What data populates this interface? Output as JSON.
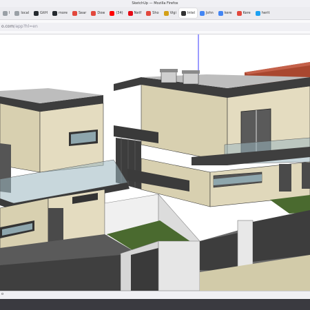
{
  "window": {
    "title": "SketchUp — Mozilla Firefox"
  },
  "tabs": [
    {
      "label": "l",
      "icon": "doc-icon",
      "color": "#9aa0a6"
    },
    {
      "label": "local",
      "icon": "doc-icon",
      "color": "#9aa0a6"
    },
    {
      "label": "GitH",
      "icon": "github-icon",
      "color": "#24292e"
    },
    {
      "label": "more",
      "icon": "github-icon",
      "color": "#24292e"
    },
    {
      "label": "Sear",
      "icon": "search-icon",
      "color": "#e2483d"
    },
    {
      "label": "Dow",
      "icon": "close-x-icon",
      "color": "#e2483d"
    },
    {
      "label": "(34)",
      "icon": "youtube-icon",
      "color": "#ff0000"
    },
    {
      "label": "Netf",
      "icon": "netflix-icon",
      "color": "#e50914"
    },
    {
      "label": "Sho",
      "icon": "shop-icon",
      "color": "#e2483d"
    },
    {
      "label": "Vigi",
      "icon": "vigi-icon",
      "color": "#d4a017"
    },
    {
      "label": "Intel",
      "icon": "sketchup-icon",
      "color": "#333333",
      "active": true
    },
    {
      "label": "John",
      "icon": "google-icon",
      "color": "#4285f4"
    },
    {
      "label": "kere",
      "icon": "google-icon",
      "color": "#4285f4"
    },
    {
      "label": "Kere",
      "icon": "ring-icon",
      "color": "#e2483d"
    },
    {
      "label": "herit",
      "icon": "twitter-icon",
      "color": "#1da1f2"
    }
  ],
  "url": {
    "prefix": "o.com",
    "path": "/app?hl=en"
  },
  "status": {
    "text": "o"
  },
  "colors": {
    "wall_beige": "#dcd5b8",
    "wall_beige_shade": "#c7bf9f",
    "dark_gray": "#4a4a4a",
    "roof_red": "#b5553d",
    "grass": "#4a6a2f",
    "pavement": "#5a5a5a",
    "glass": "#9ab7bf"
  }
}
